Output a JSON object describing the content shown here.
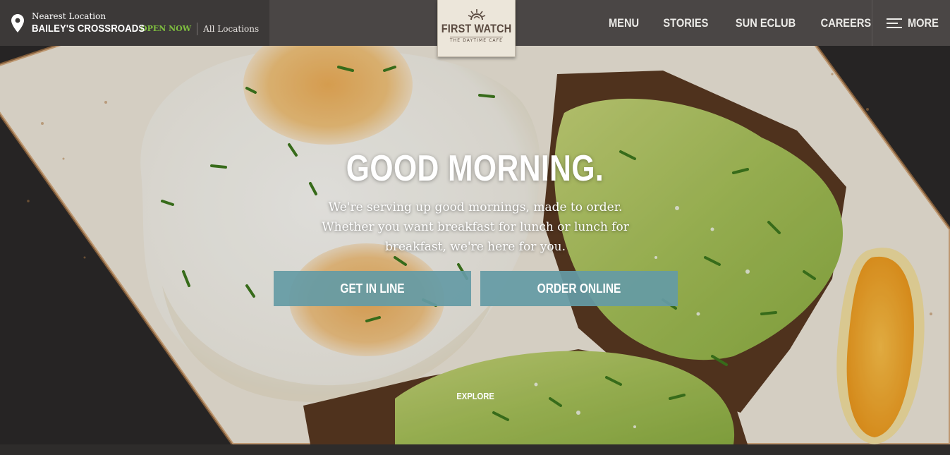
{
  "location": {
    "nearest_label": "Nearest Location",
    "name": "BAILEY'S CROSSROADS",
    "status": "OPEN NOW",
    "all_locations_label": "All Locations",
    "pin_icon": "map-pin-icon"
  },
  "logo": {
    "title": "FIRST WATCH",
    "subtitle": "THE DAYTIME CAFE",
    "icon": "sun-icon"
  },
  "nav": {
    "items": [
      {
        "label": "MENU"
      },
      {
        "label": "STORIES"
      },
      {
        "label": "SUN ECLUB"
      },
      {
        "label": "CAREERS"
      }
    ],
    "more_label": "MORE",
    "more_icon": "hamburger-icon"
  },
  "hero": {
    "headline": "GOOD MORNING.",
    "body": "We're serving up good mornings, made to order. Whether you want breakfast for lunch or lunch for breakfast, we're here for you.",
    "buttons": {
      "get_in_line": "GET IN LINE",
      "order_online": "ORDER ONLINE"
    },
    "explore_label": "EXPLORE"
  },
  "colors": {
    "header_bg": "#4a4645",
    "location_bg": "#3c3938",
    "open_status": "#7fbf3f",
    "button_bg": "#659ba5"
  }
}
